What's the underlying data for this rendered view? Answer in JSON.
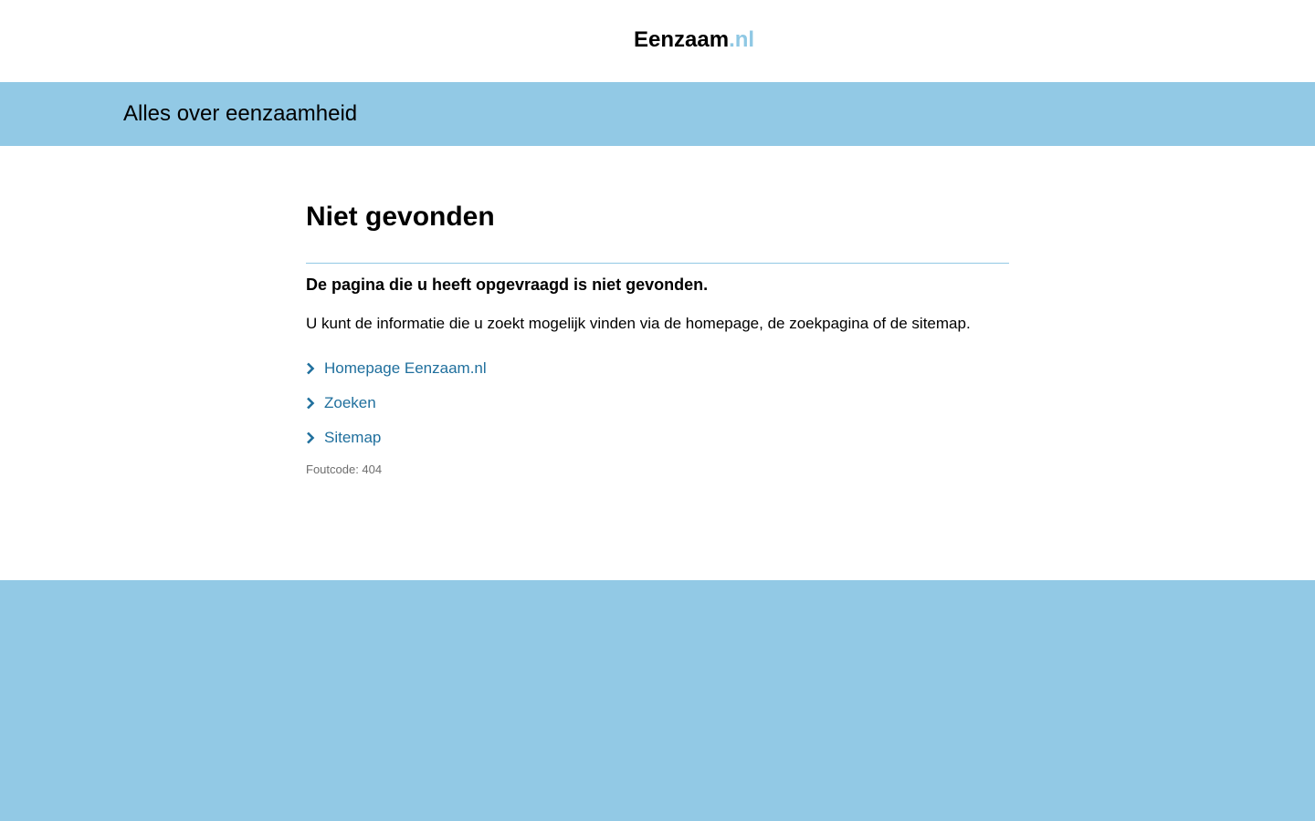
{
  "header": {
    "logo_name": "Eenzaam",
    "logo_tld": ".nl"
  },
  "band": {
    "tagline": "Alles over eenzaamheid"
  },
  "main": {
    "title": "Niet gevonden",
    "lead": "De pagina die u heeft opgevraagd is niet gevonden.",
    "intro": "U kunt de informatie die u zoekt mogelijk vinden via de homepage, de zoekpagina of de sitemap.",
    "links": [
      {
        "label": "Homepage Eenzaam.nl"
      },
      {
        "label": "Zoeken"
      },
      {
        "label": "Sitemap"
      }
    ],
    "error_code": "Foutcode: 404"
  },
  "colors": {
    "accent_blue": "#92c9e5",
    "link": "#1f6f9d",
    "muted": "#6e6e6e"
  },
  "icons": {
    "link_bullet": "chevron-right-icon"
  }
}
